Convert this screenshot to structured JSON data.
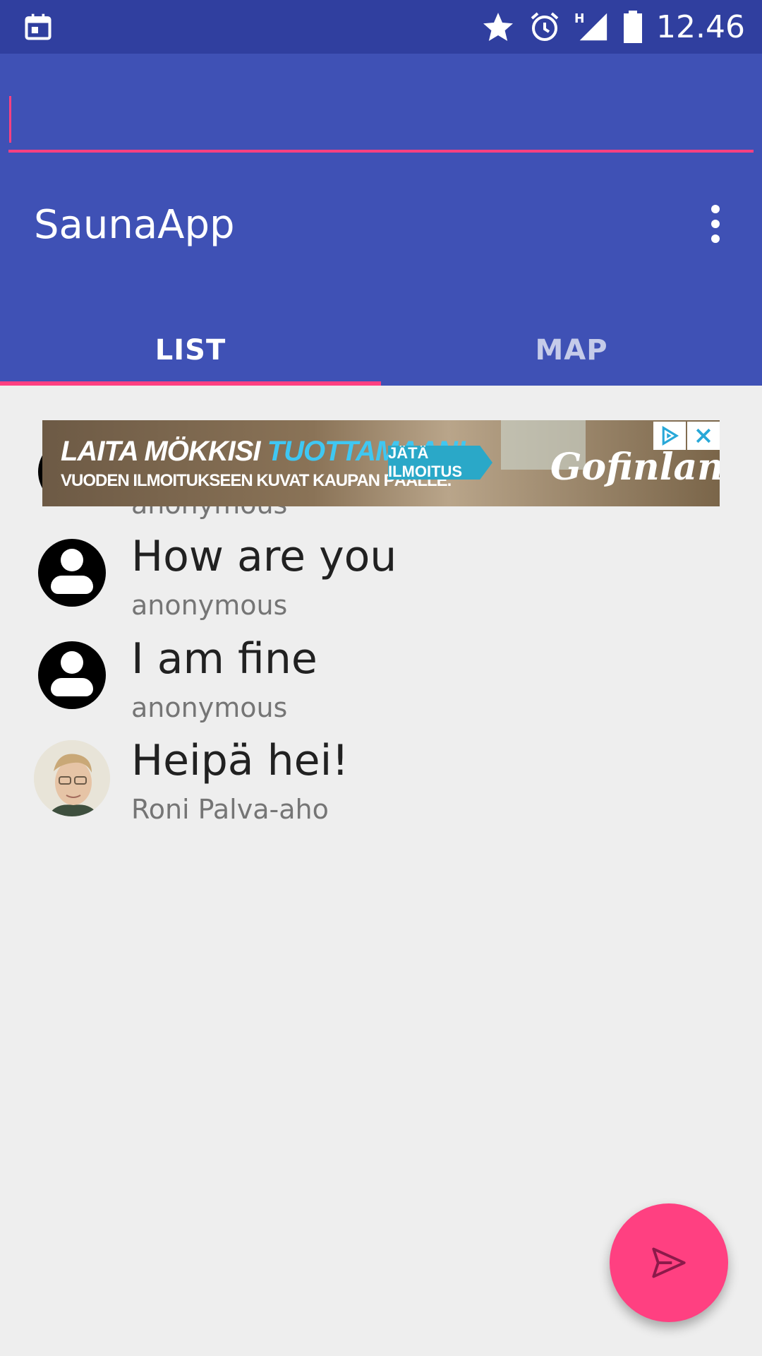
{
  "status_bar": {
    "time": "12.46",
    "icons": [
      "calendar-icon",
      "star-icon",
      "alarm-icon",
      "signal-h-icon",
      "battery-icon"
    ]
  },
  "app": {
    "title": "SaunaApp",
    "search": {
      "value": "",
      "placeholder": ""
    }
  },
  "tabs": [
    {
      "label": "LIST",
      "active": true
    },
    {
      "label": "MAP",
      "active": false
    }
  ],
  "ad": {
    "headline_part1": "LAITA MÖKKISI ",
    "headline_part2": "TUOTTAMAAN!",
    "subline": "VUODEN ILMOITUKSEEN KUVAT KAUPAN PÄÄLLE.",
    "cta": "JÄTÄ ILMOITUS",
    "brand": "Gofinland"
  },
  "messages": [
    {
      "text": "",
      "user": "anonymous",
      "avatar": "person-icon"
    },
    {
      "text": "How are you",
      "user": "anonymous",
      "avatar": "person-icon"
    },
    {
      "text": "I am fine",
      "user": "anonymous",
      "avatar": "person-icon"
    },
    {
      "text": "Heipä hei!",
      "user": "Roni Palva-aho",
      "avatar": "user-photo"
    }
  ],
  "fab": {
    "icon": "send-icon"
  },
  "colors": {
    "primary": "#3f51b5",
    "primary_dark": "#303f9f",
    "accent": "#ff4081",
    "background": "#eeeeee"
  }
}
